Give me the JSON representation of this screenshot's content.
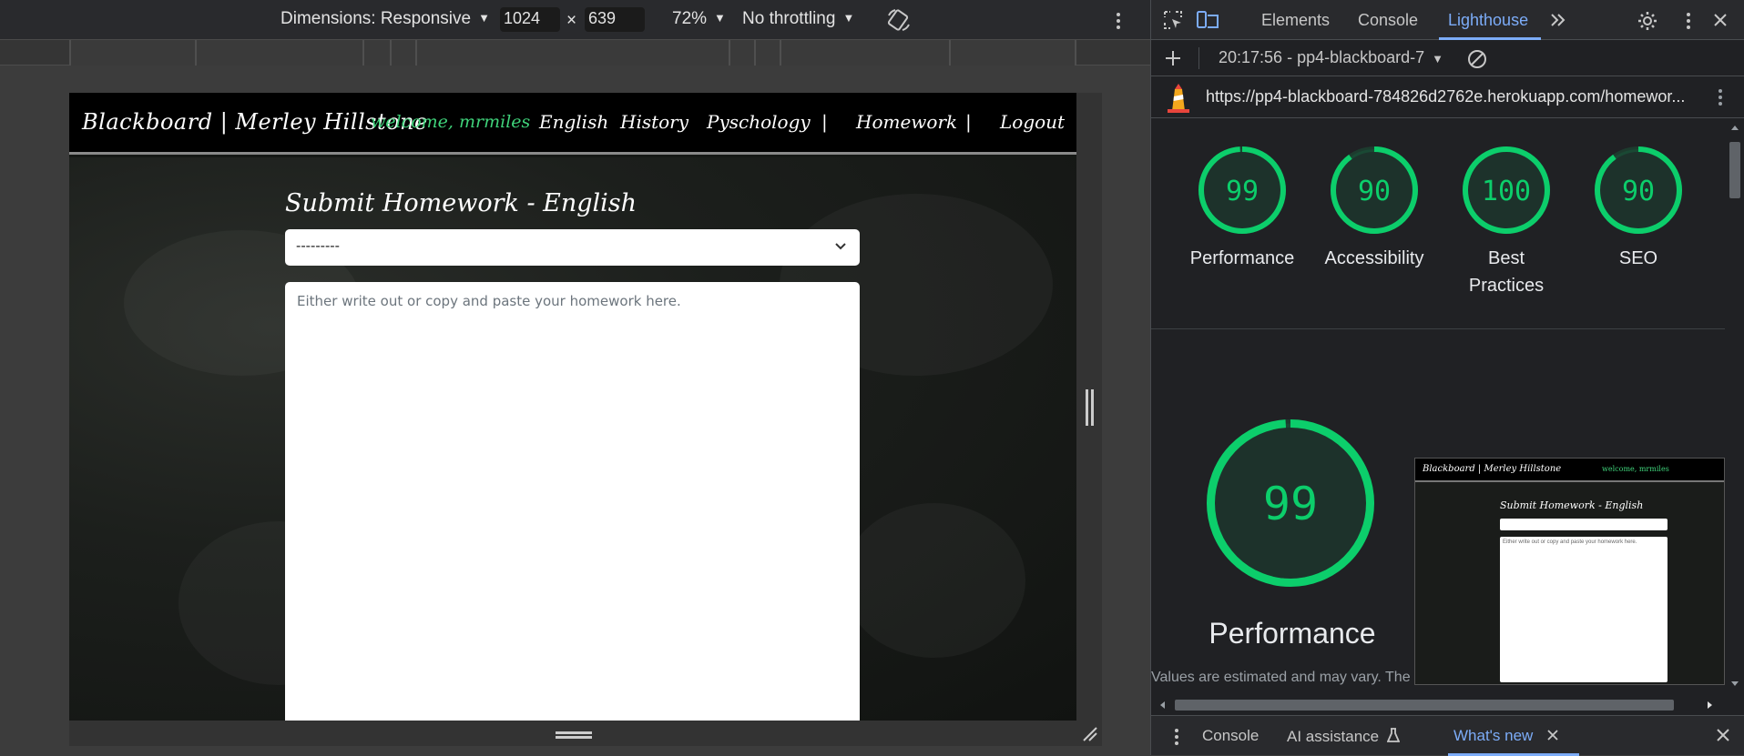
{
  "device_toolbar": {
    "dimensions_label": "Dimensions: Responsive",
    "width": "1024",
    "height": "639",
    "times": "×",
    "zoom": "72%",
    "throttling": "No throttling"
  },
  "site": {
    "brand": "Blackboard | Merley Hillstone",
    "welcome": "welcome, mrmiles",
    "nav": [
      "English",
      "History",
      "Pyschology",
      "|",
      "Homework",
      "|",
      "Logout"
    ],
    "heading": "Submit Homework - English",
    "select_value": "---------",
    "textarea_placeholder": "Either write out or copy and paste your homework here."
  },
  "devtools": {
    "tabs": [
      "Elements",
      "Console",
      "Lighthouse"
    ],
    "active_tab": "Lighthouse",
    "report_label": "20:17:56 - pp4-blackboard-7​",
    "url": "https://pp4-blackboard-784826d2762e.herokuapp.com/homewor...",
    "scores": [
      {
        "value": 99,
        "label": "Performance"
      },
      {
        "value": 90,
        "label": "Accessibility"
      },
      {
        "value": 100,
        "label": "Best Practices"
      },
      {
        "value": 90,
        "label": "SEO"
      }
    ],
    "main_score": {
      "value": 99,
      "label": "Performance"
    },
    "note": "Values are estimated and may vary. The",
    "thumbnail": {
      "brand": "Blackboard | Merley Hillstone",
      "welcome": "welcome, mrmiles",
      "heading": "Submit Homework - English",
      "placeholder": "Either write out or copy and paste your homework here."
    },
    "drawer_tabs": [
      "Console",
      "AI assistance",
      "What's new"
    ],
    "active_drawer_tab": "What's new"
  },
  "colors": {
    "score_good": "#0cce6b",
    "welcome_green": "#3fd27a",
    "devtools_accent": "#7cacf8"
  }
}
